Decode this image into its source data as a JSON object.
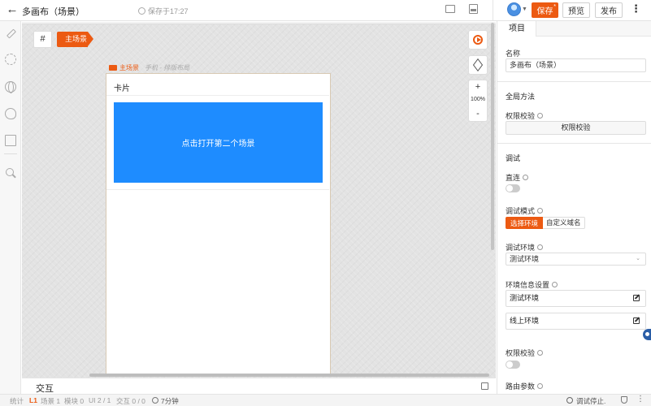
{
  "header": {
    "title": "多画布（场景）",
    "saved_text": "保存于17:27",
    "save_label": "保存",
    "save_badge": "*",
    "preview_label": "预览",
    "publish_label": "发布"
  },
  "canvas": {
    "hash_label": "#",
    "scene_tag": "主场景",
    "page_name": "主场景",
    "page_layout": "手机 - 排版布局",
    "zoom_in": "+",
    "zoom_level": "100%",
    "zoom_out": "-",
    "card_title": "卡片",
    "button_label": "点击打开第二个场景"
  },
  "interaction": {
    "label": "交互"
  },
  "status": {
    "stats": "统计",
    "level": "L1",
    "scenes": "场景 1",
    "modules": "模块 0",
    "ui": "UI 2 / 1",
    "interactions": "交互 0 / 0",
    "time": "7分钟",
    "debug": "调试停止."
  },
  "panel": {
    "tab": "项目",
    "name_label": "名称",
    "name_value": "多画布（场景）",
    "global_section": "全局方法",
    "permission_label": "权限校验",
    "permission_button": "权限校验",
    "debug_section": "调试",
    "direct_label": "直连",
    "debug_mode_label": "调试模式",
    "mode_options": [
      "选择环境",
      "自定义域名"
    ],
    "debug_env_label": "调试环境",
    "debug_env_value": "测试环境",
    "env_info_label": "环境信息设置",
    "env_items": [
      "测试环境",
      "线上环境"
    ],
    "permission_label2": "权限校验",
    "route_label": "路由参数"
  },
  "colors": {
    "accent": "#ec5a12",
    "primary_button": "#1e8cff"
  }
}
